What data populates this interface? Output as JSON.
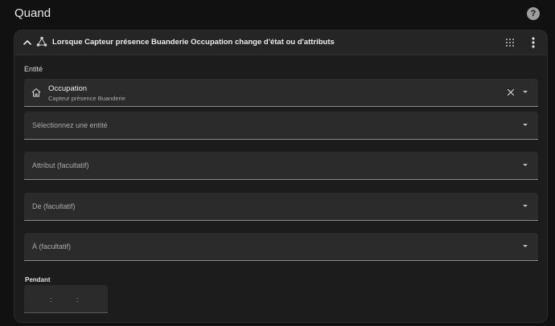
{
  "section": {
    "title": "Quand",
    "help_icon": "help-circle-icon"
  },
  "trigger": {
    "title": "Lorsque Capteur présence Buanderie Occupation change d'état ou d'attributs",
    "icon": "state-trigger-icon",
    "collapse_icon": "chevron-up-icon",
    "drag_icon": "drag-handle-icon",
    "menu_icon": "more-vertical-icon"
  },
  "entity": {
    "label": "Entité",
    "selected": {
      "name": "Occupation",
      "device": "Capteur présence Buanderie",
      "icon": "home-icon"
    },
    "add_placeholder": "Sélectionnez une entité"
  },
  "attribute": {
    "placeholder": "Attribut (facultatif)"
  },
  "from": {
    "placeholder": "De (facultatif)"
  },
  "to": {
    "placeholder": "À (facultatif)"
  },
  "for": {
    "label": "Pendant",
    "hours": "",
    "minutes": "",
    "seconds": "",
    "separator": ":"
  },
  "colors": {
    "background": "#111111",
    "card": "#1c1c1c",
    "field": "#2b2b2b",
    "text": "#e1e1e1"
  }
}
